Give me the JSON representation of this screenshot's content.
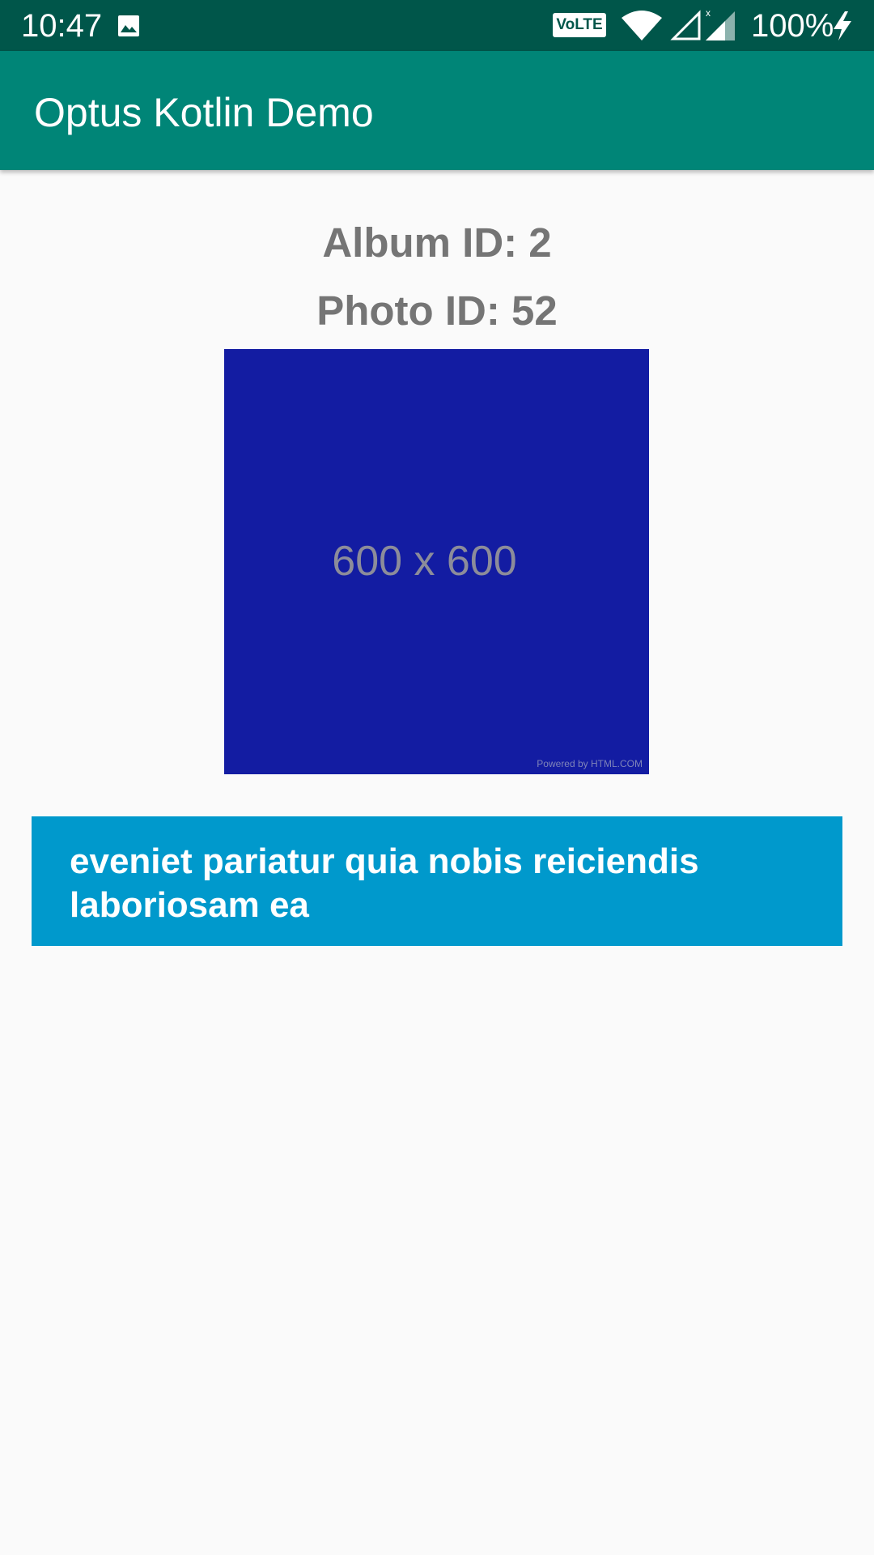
{
  "status_bar": {
    "time": "10:47",
    "volte": "VoLTE",
    "battery": "100%",
    "icons": [
      "photo-icon",
      "wifi-icon",
      "signal-icon",
      "signal-icon",
      "charging-bolt-icon"
    ],
    "background": "#00564a"
  },
  "app_bar": {
    "title": "Optus Kotlin Demo",
    "background": "#008577"
  },
  "detail": {
    "album_label": "Album ID: 2",
    "photo_label": "Photo ID: 52",
    "photo": {
      "placeholder_text": "600 x 600",
      "watermark": "Powered by HTML.COM",
      "background": "#131ca2"
    },
    "title": "eveniet pariatur quia nobis reiciendis laboriosam ea",
    "title_background": "#0099cc"
  }
}
